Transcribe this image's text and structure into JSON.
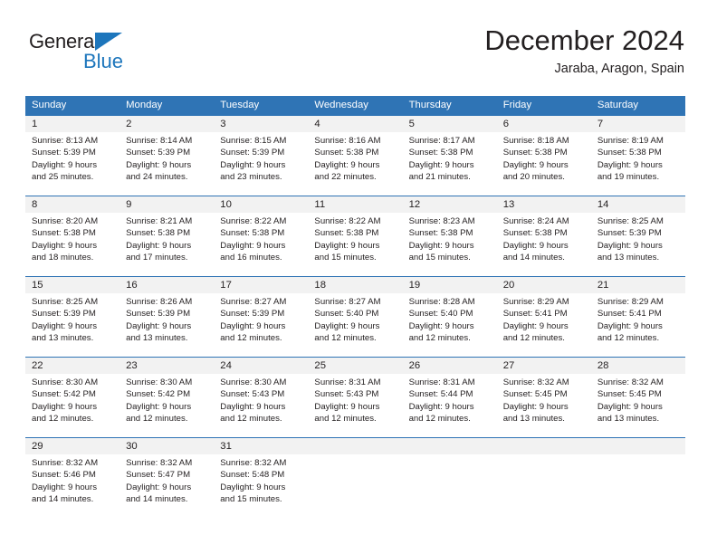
{
  "brand": {
    "name_top": "General",
    "name_bottom": "Blue",
    "accent_color": "#1d76bc"
  },
  "header": {
    "title": "December 2024",
    "location": "Jaraba, Aragon, Spain"
  },
  "theme": {
    "header_bg": "#2f74b5",
    "header_text": "#ffffff",
    "daynum_bg": "#f2f2f2",
    "text": "#231f20"
  },
  "weekdays": [
    "Sunday",
    "Monday",
    "Tuesday",
    "Wednesday",
    "Thursday",
    "Friday",
    "Saturday"
  ],
  "weeks": [
    [
      {
        "day": "1",
        "sunrise": "Sunrise: 8:13 AM",
        "sunset": "Sunset: 5:39 PM",
        "daylight1": "Daylight: 9 hours",
        "daylight2": "and 25 minutes."
      },
      {
        "day": "2",
        "sunrise": "Sunrise: 8:14 AM",
        "sunset": "Sunset: 5:39 PM",
        "daylight1": "Daylight: 9 hours",
        "daylight2": "and 24 minutes."
      },
      {
        "day": "3",
        "sunrise": "Sunrise: 8:15 AM",
        "sunset": "Sunset: 5:39 PM",
        "daylight1": "Daylight: 9 hours",
        "daylight2": "and 23 minutes."
      },
      {
        "day": "4",
        "sunrise": "Sunrise: 8:16 AM",
        "sunset": "Sunset: 5:38 PM",
        "daylight1": "Daylight: 9 hours",
        "daylight2": "and 22 minutes."
      },
      {
        "day": "5",
        "sunrise": "Sunrise: 8:17 AM",
        "sunset": "Sunset: 5:38 PM",
        "daylight1": "Daylight: 9 hours",
        "daylight2": "and 21 minutes."
      },
      {
        "day": "6",
        "sunrise": "Sunrise: 8:18 AM",
        "sunset": "Sunset: 5:38 PM",
        "daylight1": "Daylight: 9 hours",
        "daylight2": "and 20 minutes."
      },
      {
        "day": "7",
        "sunrise": "Sunrise: 8:19 AM",
        "sunset": "Sunset: 5:38 PM",
        "daylight1": "Daylight: 9 hours",
        "daylight2": "and 19 minutes."
      }
    ],
    [
      {
        "day": "8",
        "sunrise": "Sunrise: 8:20 AM",
        "sunset": "Sunset: 5:38 PM",
        "daylight1": "Daylight: 9 hours",
        "daylight2": "and 18 minutes."
      },
      {
        "day": "9",
        "sunrise": "Sunrise: 8:21 AM",
        "sunset": "Sunset: 5:38 PM",
        "daylight1": "Daylight: 9 hours",
        "daylight2": "and 17 minutes."
      },
      {
        "day": "10",
        "sunrise": "Sunrise: 8:22 AM",
        "sunset": "Sunset: 5:38 PM",
        "daylight1": "Daylight: 9 hours",
        "daylight2": "and 16 minutes."
      },
      {
        "day": "11",
        "sunrise": "Sunrise: 8:22 AM",
        "sunset": "Sunset: 5:38 PM",
        "daylight1": "Daylight: 9 hours",
        "daylight2": "and 15 minutes."
      },
      {
        "day": "12",
        "sunrise": "Sunrise: 8:23 AM",
        "sunset": "Sunset: 5:38 PM",
        "daylight1": "Daylight: 9 hours",
        "daylight2": "and 15 minutes."
      },
      {
        "day": "13",
        "sunrise": "Sunrise: 8:24 AM",
        "sunset": "Sunset: 5:38 PM",
        "daylight1": "Daylight: 9 hours",
        "daylight2": "and 14 minutes."
      },
      {
        "day": "14",
        "sunrise": "Sunrise: 8:25 AM",
        "sunset": "Sunset: 5:39 PM",
        "daylight1": "Daylight: 9 hours",
        "daylight2": "and 13 minutes."
      }
    ],
    [
      {
        "day": "15",
        "sunrise": "Sunrise: 8:25 AM",
        "sunset": "Sunset: 5:39 PM",
        "daylight1": "Daylight: 9 hours",
        "daylight2": "and 13 minutes."
      },
      {
        "day": "16",
        "sunrise": "Sunrise: 8:26 AM",
        "sunset": "Sunset: 5:39 PM",
        "daylight1": "Daylight: 9 hours",
        "daylight2": "and 13 minutes."
      },
      {
        "day": "17",
        "sunrise": "Sunrise: 8:27 AM",
        "sunset": "Sunset: 5:39 PM",
        "daylight1": "Daylight: 9 hours",
        "daylight2": "and 12 minutes."
      },
      {
        "day": "18",
        "sunrise": "Sunrise: 8:27 AM",
        "sunset": "Sunset: 5:40 PM",
        "daylight1": "Daylight: 9 hours",
        "daylight2": "and 12 minutes."
      },
      {
        "day": "19",
        "sunrise": "Sunrise: 8:28 AM",
        "sunset": "Sunset: 5:40 PM",
        "daylight1": "Daylight: 9 hours",
        "daylight2": "and 12 minutes."
      },
      {
        "day": "20",
        "sunrise": "Sunrise: 8:29 AM",
        "sunset": "Sunset: 5:41 PM",
        "daylight1": "Daylight: 9 hours",
        "daylight2": "and 12 minutes."
      },
      {
        "day": "21",
        "sunrise": "Sunrise: 8:29 AM",
        "sunset": "Sunset: 5:41 PM",
        "daylight1": "Daylight: 9 hours",
        "daylight2": "and 12 minutes."
      }
    ],
    [
      {
        "day": "22",
        "sunrise": "Sunrise: 8:30 AM",
        "sunset": "Sunset: 5:42 PM",
        "daylight1": "Daylight: 9 hours",
        "daylight2": "and 12 minutes."
      },
      {
        "day": "23",
        "sunrise": "Sunrise: 8:30 AM",
        "sunset": "Sunset: 5:42 PM",
        "daylight1": "Daylight: 9 hours",
        "daylight2": "and 12 minutes."
      },
      {
        "day": "24",
        "sunrise": "Sunrise: 8:30 AM",
        "sunset": "Sunset: 5:43 PM",
        "daylight1": "Daylight: 9 hours",
        "daylight2": "and 12 minutes."
      },
      {
        "day": "25",
        "sunrise": "Sunrise: 8:31 AM",
        "sunset": "Sunset: 5:43 PM",
        "daylight1": "Daylight: 9 hours",
        "daylight2": "and 12 minutes."
      },
      {
        "day": "26",
        "sunrise": "Sunrise: 8:31 AM",
        "sunset": "Sunset: 5:44 PM",
        "daylight1": "Daylight: 9 hours",
        "daylight2": "and 12 minutes."
      },
      {
        "day": "27",
        "sunrise": "Sunrise: 8:32 AM",
        "sunset": "Sunset: 5:45 PM",
        "daylight1": "Daylight: 9 hours",
        "daylight2": "and 13 minutes."
      },
      {
        "day": "28",
        "sunrise": "Sunrise: 8:32 AM",
        "sunset": "Sunset: 5:45 PM",
        "daylight1": "Daylight: 9 hours",
        "daylight2": "and 13 minutes."
      }
    ],
    [
      {
        "day": "29",
        "sunrise": "Sunrise: 8:32 AM",
        "sunset": "Sunset: 5:46 PM",
        "daylight1": "Daylight: 9 hours",
        "daylight2": "and 14 minutes."
      },
      {
        "day": "30",
        "sunrise": "Sunrise: 8:32 AM",
        "sunset": "Sunset: 5:47 PM",
        "daylight1": "Daylight: 9 hours",
        "daylight2": "and 14 minutes."
      },
      {
        "day": "31",
        "sunrise": "Sunrise: 8:32 AM",
        "sunset": "Sunset: 5:48 PM",
        "daylight1": "Daylight: 9 hours",
        "daylight2": "and 15 minutes."
      },
      {
        "day": "",
        "sunrise": "",
        "sunset": "",
        "daylight1": "",
        "daylight2": ""
      },
      {
        "day": "",
        "sunrise": "",
        "sunset": "",
        "daylight1": "",
        "daylight2": ""
      },
      {
        "day": "",
        "sunrise": "",
        "sunset": "",
        "daylight1": "",
        "daylight2": ""
      },
      {
        "day": "",
        "sunrise": "",
        "sunset": "",
        "daylight1": "",
        "daylight2": ""
      }
    ]
  ]
}
